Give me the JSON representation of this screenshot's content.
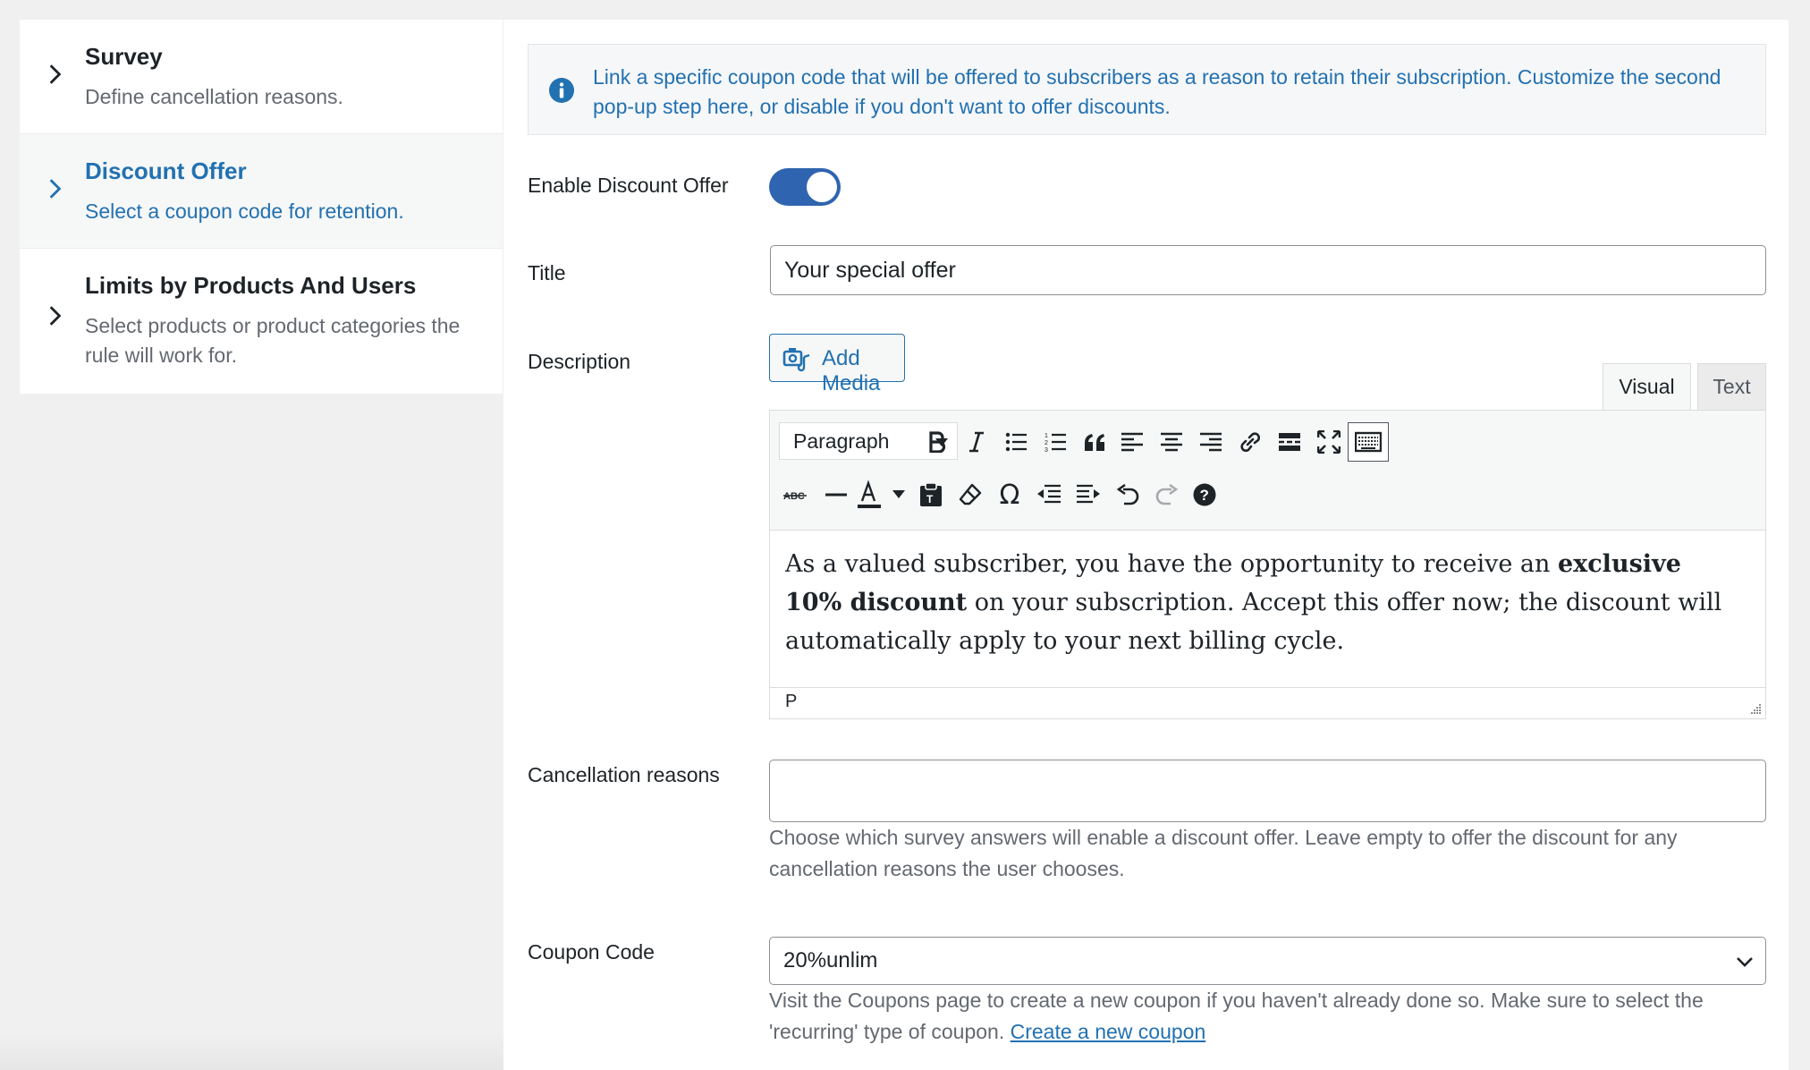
{
  "sidebar": {
    "items": [
      {
        "title": "Survey",
        "desc": "Define cancellation reasons."
      },
      {
        "title": "Discount Offer",
        "desc": "Select a coupon code for retention."
      },
      {
        "title": "Limits by Products And Users",
        "desc": "Select products or product categories the rule will work for."
      }
    ]
  },
  "notice": {
    "text": "Link a specific coupon code that will be offered to subscribers as a reason to retain their subscription. Customize the second pop-up step here, or disable if you don't want to offer discounts."
  },
  "form": {
    "enable_label": "Enable Discount Offer",
    "enable_value": true,
    "title_label": "Title",
    "title_value": "Your special offer",
    "description_label": "Description",
    "add_media_label": "Add Media",
    "tab_visual": "Visual",
    "tab_text": "Text",
    "format_select": "Paragraph",
    "content_part1": "As a valued subscriber, you have the opportunity to receive an ",
    "content_bold": "exclusive 10% discount",
    "content_part2": " on your subscription. Accept this offer now; the discount will automatically apply to your next billing cycle.",
    "status_path": "P",
    "cancel_label": "Cancellation reasons",
    "cancel_value": "",
    "cancel_help": "Choose which survey answers will enable a discount offer. Leave empty to offer the discount for any cancellation reasons the user chooses.",
    "coupon_label": "Coupon Code",
    "coupon_value": "20%unlim",
    "coupon_help": "Visit the Coupons page to create a new coupon if you haven't already done so. Make sure to select the 'recurring' type of coupon.",
    "coupon_link": "Create a new coupon"
  },
  "toolbar": {
    "row1_icons": [
      "bold-icon",
      "italic-icon",
      "bullet-list-icon",
      "numbered-list-icon",
      "blockquote-icon",
      "align-left-icon",
      "align-center-icon",
      "align-right-icon",
      "link-icon",
      "read-more-icon",
      "fullscreen-icon",
      "toolbar-toggle-icon"
    ],
    "row2_icons": [
      "strikethrough-icon",
      "horizontal-line-icon",
      "text-color-icon",
      "paste-text-icon",
      "clear-formatting-icon",
      "special-character-icon",
      "outdent-icon",
      "indent-icon",
      "undo-icon",
      "redo-icon",
      "help-icon"
    ]
  },
  "colors": {
    "accent": "#2271b1",
    "toggle": "#2f64b0",
    "page_bg": "#f0f0f1"
  }
}
